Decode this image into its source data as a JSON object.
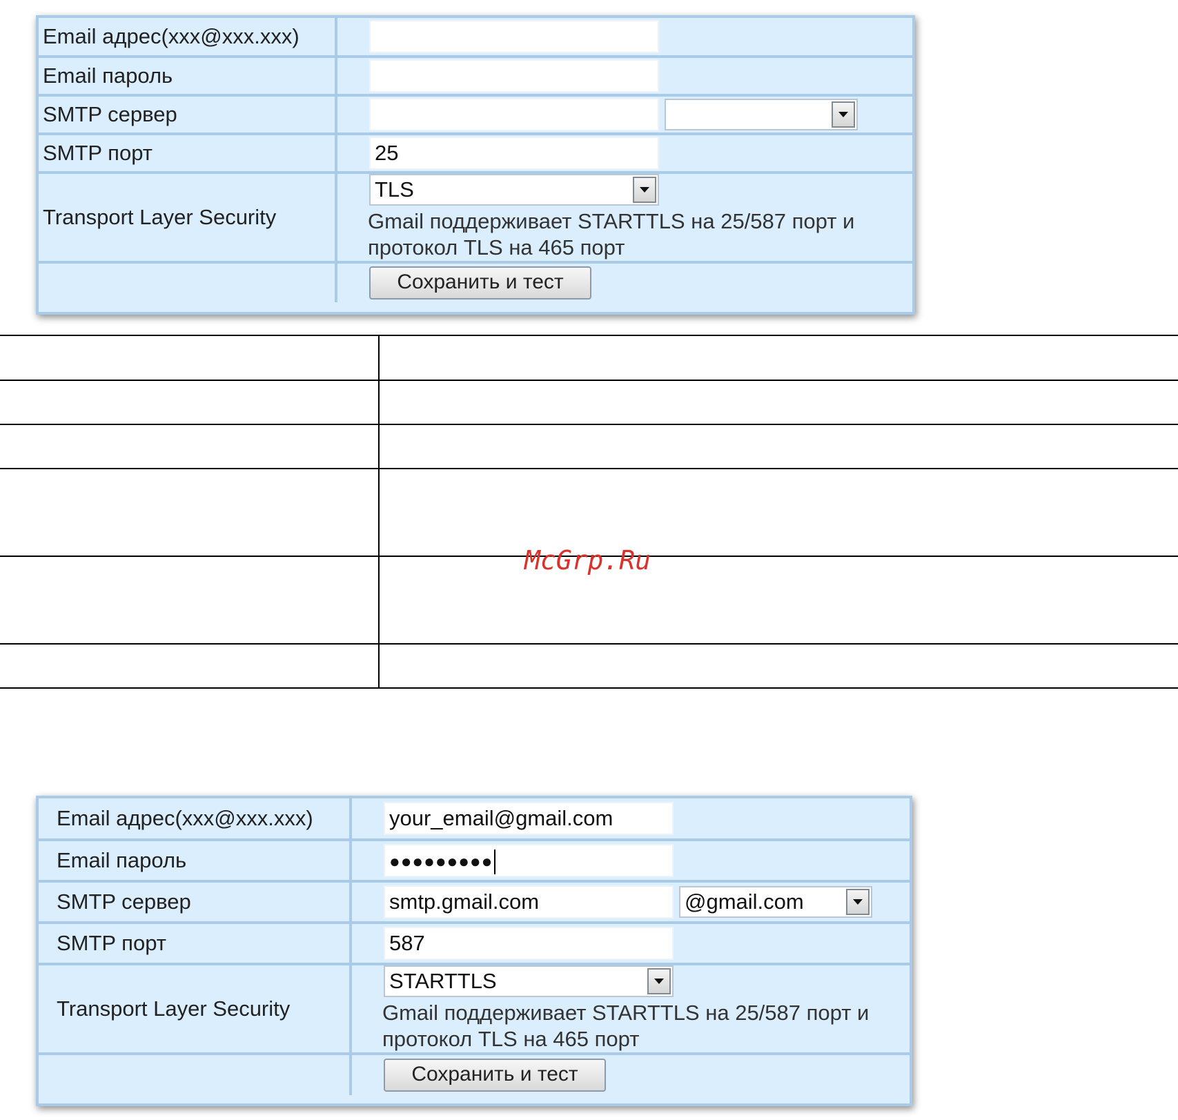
{
  "top_form": {
    "email_label": "Email адрес(xxx@xxx.xxx)",
    "email_value": "",
    "password_label": "Email пароль",
    "password_value": "",
    "smtp_server_label": "SMTP сервер",
    "smtp_server_value": "",
    "smtp_domain_selected": "",
    "smtp_port_label": "SMTP порт",
    "smtp_port_value": "25",
    "tls_label": "Transport Layer Security",
    "tls_selected": "TLS",
    "tls_hint": "Gmail поддерживает STARTTLS на 25/587 порт и протокол TLS на 465 порт",
    "save_button": "Сохранить и тест"
  },
  "bottom_form": {
    "email_label": "Email адрес(xxx@xxx.xxx)",
    "email_value": "your_email@gmail.com",
    "password_label": "Email пароль",
    "password_value": "●●●●●●●●●",
    "smtp_server_label": "SMTP сервер",
    "smtp_server_value": "smtp.gmail.com",
    "smtp_domain_selected": "@gmail.com",
    "smtp_port_label": "SMTP порт",
    "smtp_port_value": "587",
    "tls_label": "Transport Layer Security",
    "tls_selected": "STARTTLS",
    "tls_hint": "Gmail поддерживает STARTTLS на 25/587 порт и протокол TLS на 465 порт",
    "save_button": "Сохранить и тест"
  },
  "watermark": "McGrp.Ru",
  "colors": {
    "panel_bg": "#dbeefd",
    "panel_border": "#a9cbe8",
    "watermark": "#d8322b"
  }
}
